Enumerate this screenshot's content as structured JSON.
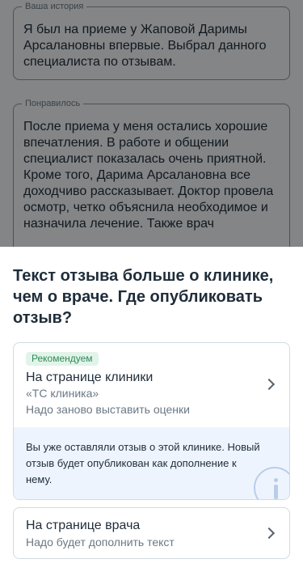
{
  "form": {
    "story": {
      "label": "Ваша история",
      "text": "Я был на приеме у Жаповой Даримы Арсалановны впервые. Выбрал данного специалиста по отзывам."
    },
    "liked": {
      "label": "Понравилось",
      "text": "После приема у меня остались хорошие впечатления. В работе и общении специалист показалась очень приятной. Кроме того, Дарима Арсалановна все доходчиво рассказывает. Доктор провела осмотр, четко объяснила необходимое и назначила лечение. Также врач"
    }
  },
  "sheet": {
    "title": "Текст отзыва больше о клинике, чем о враче. Где опубликовать отзыв?",
    "clinic_option": {
      "badge": "Рекомендуем",
      "title": "На странице клиники",
      "clinic_name": "«ТС клиника»",
      "subtitle": "Надо заново выставить оценки",
      "info": "Вы уже оставляли отзыв о этой клинике. Новый отзыв будет опубликован как дополнение к нему.",
      "icon": "info-icon"
    },
    "doctor_option": {
      "title": "На странице врача",
      "subtitle": "Надо будет дополнить текст"
    }
  },
  "colors": {
    "badge_bg": "#e2f4ea",
    "badge_text": "#2e8a56",
    "info_bg": "#eef4fd",
    "overlay": "rgba(0,0,0,0.45)"
  }
}
